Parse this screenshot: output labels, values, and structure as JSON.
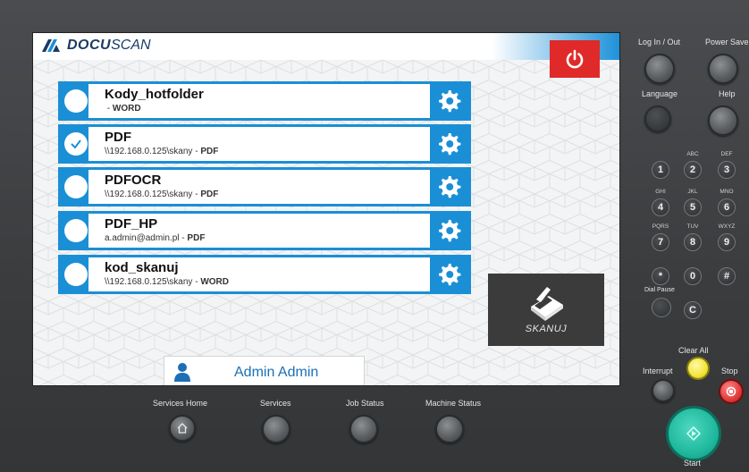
{
  "app": {
    "brand_bold": "DOCU",
    "brand_light": "SCAN"
  },
  "hotfolders": [
    {
      "name": "Kody_hotfolder",
      "path": "",
      "format": "WORD",
      "selected": false
    },
    {
      "name": "PDF",
      "path": "\\\\192.168.0.125\\skany",
      "format": "PDF",
      "selected": true
    },
    {
      "name": "PDFOCR",
      "path": "\\\\192.168.0.125\\skany",
      "format": "PDF",
      "selected": false
    },
    {
      "name": "PDF_HP",
      "path": "a.admin@admin.pl",
      "format": "PDF",
      "selected": false
    },
    {
      "name": "kod_skanuj",
      "path": "\\\\192.168.0.125\\skany",
      "format": "WORD",
      "selected": false
    }
  ],
  "separator": " - ",
  "scan_button": {
    "label": "SKANUJ"
  },
  "user": {
    "name": "Admin Admin"
  },
  "colors": {
    "accent": "#1b8fd6",
    "power": "#e02a2a",
    "start": "#20b99e",
    "clear": "#f2e53a",
    "stop": "#e13b3b"
  },
  "panel": {
    "log_in_out": "Log In / Out",
    "power_saver": "Power Saver",
    "language": "Language",
    "help": "Help",
    "clear_all": "Clear All",
    "interrupt": "Interrupt",
    "stop": "Stop",
    "start": "Start",
    "dial_pause": "Dial Pause",
    "services_home": "Services Home",
    "services": "Services",
    "job_status": "Job Status",
    "machine_status": "Machine Status",
    "keys": [
      {
        "digit": "1",
        "letters": ""
      },
      {
        "digit": "2",
        "letters": "ABC"
      },
      {
        "digit": "3",
        "letters": "DEF"
      },
      {
        "digit": "4",
        "letters": "GHI"
      },
      {
        "digit": "5",
        "letters": "JKL"
      },
      {
        "digit": "6",
        "letters": "MNO"
      },
      {
        "digit": "7",
        "letters": "PQRS"
      },
      {
        "digit": "8",
        "letters": "TUV"
      },
      {
        "digit": "9",
        "letters": "WXYZ"
      },
      {
        "digit": "*",
        "letters": ""
      },
      {
        "digit": "0",
        "letters": ""
      },
      {
        "digit": "#",
        "letters": ""
      },
      {
        "digit": "C",
        "letters": ""
      }
    ]
  }
}
